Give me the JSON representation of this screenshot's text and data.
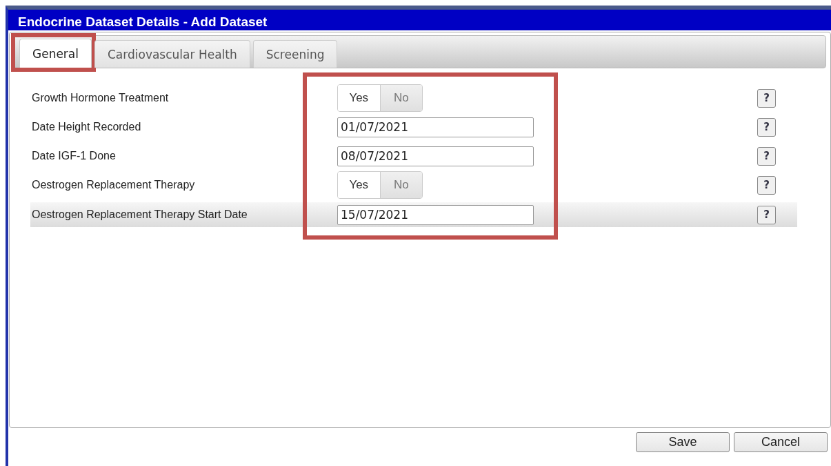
{
  "window": {
    "title": "Endocrine Dataset Details - Add Dataset"
  },
  "tabs": [
    {
      "label": "General",
      "selected": true,
      "highlighted": true
    },
    {
      "label": "Cardiovascular Health",
      "selected": false,
      "highlighted": false
    },
    {
      "label": "Screening",
      "selected": false,
      "highlighted": false
    }
  ],
  "form": {
    "highlighted": true,
    "rows": [
      {
        "kind": "toggle",
        "label": "Growth Hormone Treatment",
        "options": [
          {
            "label": "Yes",
            "selected": true
          },
          {
            "label": "No",
            "selected": false
          }
        ],
        "help": "?",
        "selected": false
      },
      {
        "kind": "date",
        "label": "Date Height Recorded",
        "value": "01/07/2021",
        "help": "?",
        "selected": false
      },
      {
        "kind": "date",
        "label": "Date IGF-1 Done",
        "value": "08/07/2021",
        "help": "?",
        "selected": false
      },
      {
        "kind": "toggle",
        "label": "Oestrogen Replacement Therapy",
        "options": [
          {
            "label": "Yes",
            "selected": true
          },
          {
            "label": "No",
            "selected": false
          }
        ],
        "help": "?",
        "selected": false
      },
      {
        "kind": "date",
        "label": "Oestrogen Replacement Therapy Start Date",
        "value": "15/07/2021",
        "help": "?",
        "selected": true
      }
    ]
  },
  "buttons": [
    "Save",
    "Cancel"
  ]
}
